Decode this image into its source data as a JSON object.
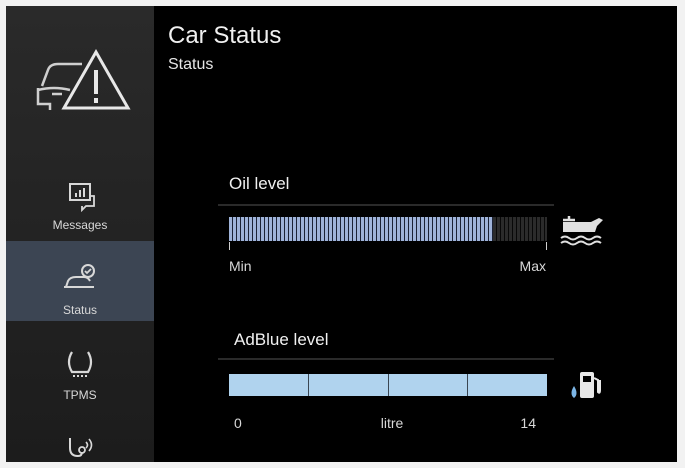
{
  "header": {
    "title": "Car Status",
    "subtitle": "Status"
  },
  "sidebar": {
    "items": [
      {
        "label": "Messages",
        "icon": "messages-icon",
        "active": false
      },
      {
        "label": "Status",
        "icon": "car-status-icon",
        "active": true
      },
      {
        "label": "TPMS",
        "icon": "tire-pressure-icon",
        "active": false
      },
      {
        "label": "",
        "icon": "service-connect-icon",
        "active": false
      }
    ]
  },
  "oil": {
    "title": "Oil level",
    "min_label": "Min",
    "max_label": "Max",
    "level_fraction": 0.83,
    "icon": "oil-can-icon"
  },
  "adblue": {
    "title": "AdBlue level",
    "min_label": "0",
    "unit_label": "litre",
    "max_label": "14",
    "level_litres": 14,
    "icon": "fuel-pump-icon"
  },
  "colors": {
    "active_nav": "#3c4553",
    "oil_bar": "#9fb3d9",
    "adblue_bar": "#b0d3ee"
  }
}
